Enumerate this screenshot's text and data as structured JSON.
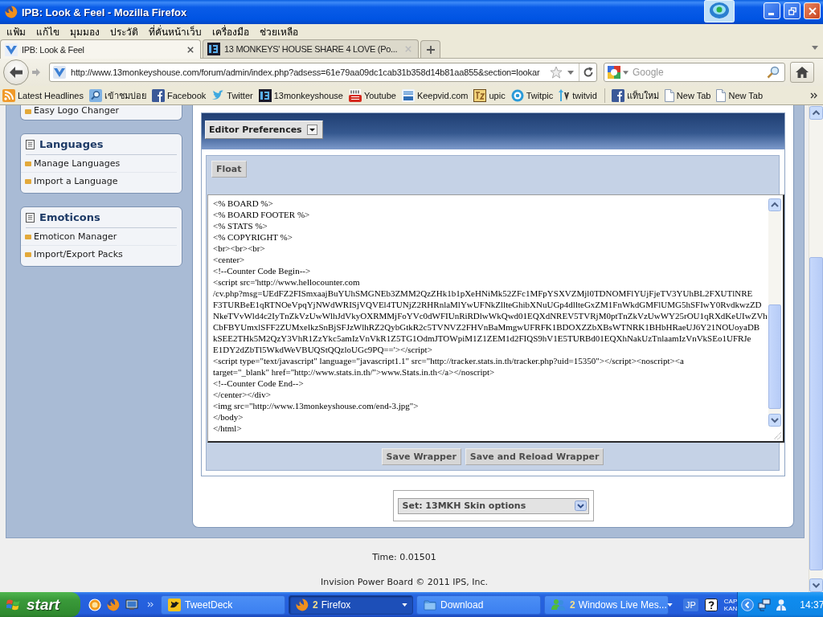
{
  "window": {
    "title": "IPB: Look & Feel - Mozilla Firefox"
  },
  "menu_bar": [
    "แฟ้ม",
    "แก้ไข",
    "มุมมอง",
    "ประวัติ",
    "ที่คั่นหน้าเว็บ",
    "เครื่องมือ",
    "ช่วยเหลือ"
  ],
  "tabs": [
    {
      "label": "IPB: Look & Feel",
      "selected": true,
      "kind": "ipb"
    },
    {
      "label": "13 MONKEYS' HOUSE SHARE 4 LOVE (Po...",
      "selected": false,
      "kind": "site"
    }
  ],
  "navigation": {
    "url": "http://www.13monkeyshouse.com/forum/admin/index.php?adsess=61e79aa09dc1cab31b358d14b81aa855&section=lookar",
    "search": {
      "placeholder": "Google"
    }
  },
  "bookmarks": [
    {
      "label": "Latest Headlines",
      "kind": "rss"
    },
    {
      "label": "เข้าชมบ่อย",
      "kind": "search"
    },
    {
      "label": "Facebook",
      "kind": "facebook"
    },
    {
      "label": "Twitter",
      "kind": "twitter"
    },
    {
      "label": "13monkeyshouse",
      "kind": "site"
    },
    {
      "label": "Youtube",
      "kind": "youtube"
    },
    {
      "label": "Keepvid.com",
      "kind": "keepvid"
    },
    {
      "label": "upic",
      "kind": "upic"
    },
    {
      "label": "Twitpic",
      "kind": "twitpic"
    },
    {
      "label": "twitvid",
      "kind": "twitvid"
    },
    {
      "kind": "separator"
    },
    {
      "label": "แท็บใหม่",
      "kind": "facebook"
    },
    {
      "label": "New Tab",
      "kind": "page"
    },
    {
      "label": "New Tab",
      "kind": "page"
    }
  ],
  "sidebar": {
    "groups": [
      {
        "items": [
          "Easy Logo Changer"
        ]
      },
      {
        "title": "Languages",
        "items": [
          "Manage Languages",
          "Import a Language"
        ]
      },
      {
        "title": "Emoticons",
        "items": [
          "Emoticon Manager",
          "Import/Export Packs"
        ]
      }
    ]
  },
  "wrapper_editor": {
    "preferences_menu": "Editor Preferences",
    "float_button": "Float",
    "lines": [
      "<% BOARD %>",
      "<% BOARD FOOTER %>",
      "<% STATS %>",
      "<% COPYRIGHT %>",
      "<br><br><br>",
      "<center>",
      "<!--Counter Code Begin-->",
      "<script src='http://www.hellocounter.com",
      "/cv.php?msg=UEdFZ2FISmxaajBuYUhSMGNEb3ZMM2QzZHk1b1pXeHNiMk52ZFc1MFpYSXVZMjl0TDNOMFlYUjFjeTV3YUhBL2FXUTlNRE",
      "F3TURBeE1qRTNOeVpqYjNWdWRISjVQVEl4TUNjZ2RHRnlaMlYwUFNkZllteGhibXNuUGp4dllteGxZM1FnWkdGMFlUMG5hSFIwY0RvdkwzZD",
      "NkeTVvWld4c2IyTnZkVzUwWlhJdVkyOXRMMjFoYVc0dWFIUnRiRDlwWkQwd01EQXdNREV5TVRjM0ptTnZkVzUwWY25rOU1qRXdKeUIwZVh",
      "CbFBYUmxlSFF2ZUMxelkzSnBjSFJzWlhRZ2QybGtkR2c5TVNVZ2FHVnBaMmgwUFRFK1BDOXZZbXBsWTNRK1BHbHRaeUJ6Y21NOUoyaDB",
      "kSEE2THk5M2QzY3VhR1ZzYkc5amIzVnVkR1Z5TG1OdmJTOWpiM1Z1ZEM1d2FIQS9hV1E5TURBd01EQXhNakUzTnlaamIzVnVkSEo1UFRJe",
      "E1DY2dZbTl5WkdWeVBUQStQQzloUGc9PQ=='></script>",
      "<script type=\"text/javascript\" language=\"javascript1.1\" src=\"http://tracker.stats.in.th/tracker.php?uid=15350\"></script><noscript><a",
      "target=\"_blank\" href=\"http://www.stats.in.th/\">www.Stats.in.th</a></noscript>",
      "<!--Counter Code End-->",
      "</center></div>",
      "<img src=\"http://www.13monkeyshouse.com/end-3.jpg\">",
      "</body>",
      "</html>"
    ],
    "buttons": [
      "Save Wrapper",
      "Save and Reload Wrapper"
    ]
  },
  "skin_select": {
    "value": "Set: 13MKH Skin options"
  },
  "footer": {
    "time": "Time: 0.01501",
    "copyright": "Invision Power Board © 2011 IPS, Inc."
  },
  "taskbar": {
    "start": "start",
    "tasks": [
      {
        "label": "TweetDeck",
        "selected": false,
        "grouped": false,
        "kind": "tweetdeck"
      },
      {
        "count": "2",
        "label": "Firefox",
        "selected": true,
        "grouped": true,
        "kind": "firefox"
      },
      {
        "label": "Download",
        "selected": false,
        "grouped": false,
        "kind": "folder"
      },
      {
        "count": "2",
        "label": "Windows Live Mes...",
        "selected": false,
        "grouped": true,
        "kind": "messenger"
      }
    ],
    "tray": {
      "language": "JP",
      "indicator": [
        "CAP",
        "KAN"
      ],
      "clock": "14:37"
    }
  }
}
